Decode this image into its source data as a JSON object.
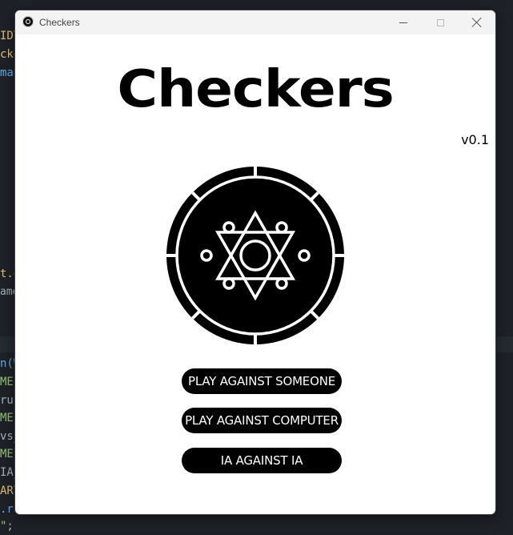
{
  "background_code": {
    "lines": [
      {
        "text": "IDT",
        "color": "#e5c07b"
      },
      {
        "text": "cker",
        "color": "#e5c07b"
      },
      {
        "text": "mag",
        "color": "#61afef"
      },
      {
        "text": "t.g",
        "color": "#e5c07b"
      },
      {
        "text": "ame",
        "color": "#abb2bf"
      },
      {
        "text": "n(W",
        "color": "#61afef"
      },
      {
        "text": "ME(",
        "color": "#98c379"
      },
      {
        "text": "run",
        "color": "#abb2bf"
      },
      {
        "text": "ME(",
        "color": "#98c379"
      },
      {
        "text": "vs_",
        "color": "#abb2bf"
      },
      {
        "text": "ME(",
        "color": "#98c379"
      },
      {
        "text": "IA_",
        "color": "#abb2bf"
      },
      {
        "text": "ART",
        "color": "#e5c07b"
      },
      {
        "text": ".ru",
        "color": "#61afef"
      },
      {
        "text": "\";",
        "color": "#98c379"
      }
    ]
  },
  "window": {
    "title": "Checkers",
    "controls": {
      "minimize": "minimize",
      "maximize": "maximize",
      "close": "close"
    }
  },
  "main": {
    "title": "Checkers",
    "version": "v0.1",
    "logo_icon": "hexagram-coin-icon",
    "buttons": [
      {
        "label": "PLAY AGAINST SOMEONE"
      },
      {
        "label": "PLAY AGAINST COMPUTER"
      },
      {
        "label": "IA AGAINST IA"
      }
    ]
  },
  "colors": {
    "background": "#1e2127",
    "window": "#ffffff",
    "titlebar": "#f3f3f3",
    "button": "#000000",
    "button_text": "#ffffff"
  }
}
